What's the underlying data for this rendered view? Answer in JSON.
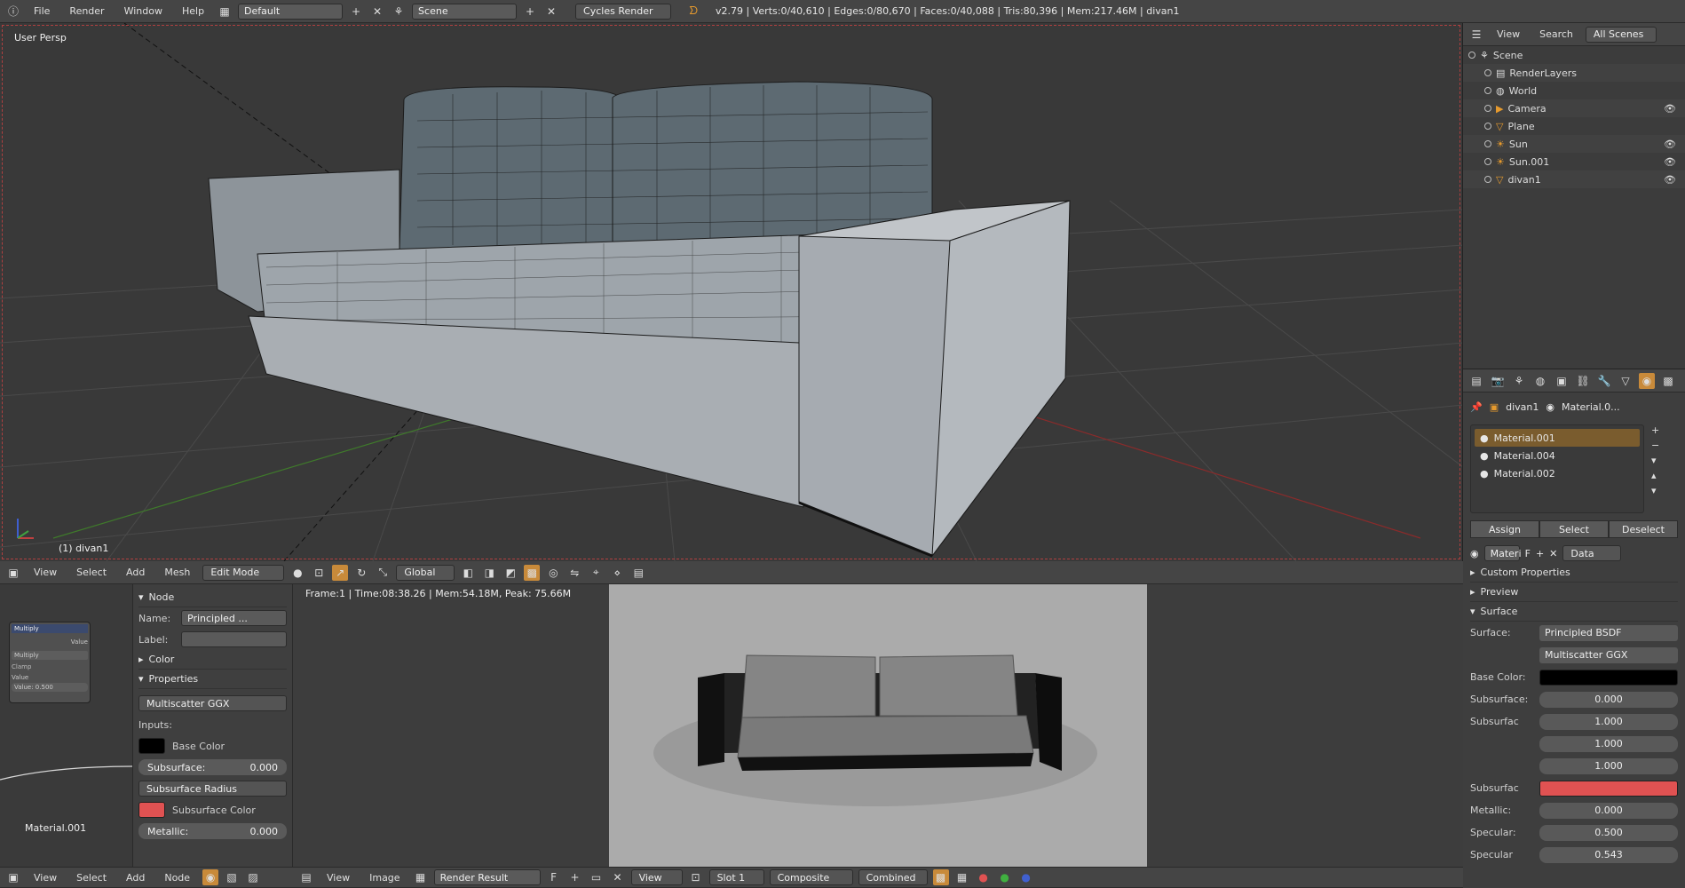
{
  "colors": {
    "accent": "#7a5c2e",
    "base_color": "#000000",
    "subsurface_color": "#e05252",
    "grid": "#4a4a4a",
    "x_axis": "#8a2b2b",
    "y_axis": "#3f7a2b"
  },
  "topbar": {
    "menus": [
      "File",
      "Render",
      "Window",
      "Help"
    ],
    "layout": "Default",
    "scene": "Scene",
    "engine": "Cycles Render",
    "info": "v2.79 | Verts:0/40,610 | Edges:0/80,670 | Faces:0/40,088 | Tris:80,396 | Mem:217.46M | divan1"
  },
  "viewport": {
    "view_label": "User Persp",
    "object_label": "(1) divan1",
    "header": {
      "menus": [
        "View",
        "Select",
        "Add",
        "Mesh"
      ],
      "mode": "Edit Mode",
      "orientation": "Global"
    }
  },
  "node_editor": {
    "node_title": "Multiply",
    "node_output": "Value",
    "node_op": "Multiply",
    "node_clamp": "Clamp",
    "node_value_label": "Value",
    "node_value": "Value:  0.500",
    "material_name": "Material.001"
  },
  "node_sidebar": {
    "node_section": "Node",
    "name_label": "Name:",
    "name_value": "Principled ...",
    "label_label": "Label:",
    "color_section": "Color",
    "properties_section": "Properties",
    "distribution": "Multiscatter GGX",
    "inputs_label": "Inputs:",
    "base_color_label": "Base Color",
    "subsurface_label": "Subsurface:",
    "subsurface_value": "0.000",
    "subsurface_radius": "Subsurface Radius",
    "subsurface_color_label": "Subsurface Color",
    "metallic_label": "Metallic:",
    "metallic_value": "0.000"
  },
  "image_editor": {
    "status": "Frame:1 | Time:08:38.26 | Mem:54.18M, Peak: 75.66M",
    "header": {
      "menus": [
        "View",
        "Image"
      ],
      "image": "Render Result",
      "fake_user": "F",
      "view": "View",
      "slot": "Slot 1",
      "layer": "Composite",
      "pass": "Combined"
    }
  },
  "bottom_left_header": {
    "menus": [
      "View",
      "Select",
      "Add",
      "Node"
    ]
  },
  "outliner": {
    "header": {
      "view": "View",
      "search": "Search",
      "filter": "All Scenes"
    },
    "items": [
      {
        "label": "Scene",
        "indent": 0
      },
      {
        "label": "RenderLayers",
        "indent": 1
      },
      {
        "label": "World",
        "indent": 1
      },
      {
        "label": "Camera",
        "indent": 1
      },
      {
        "label": "Plane",
        "indent": 1
      },
      {
        "label": "Sun",
        "indent": 1
      },
      {
        "label": "Sun.001",
        "indent": 1
      },
      {
        "label": "divan1",
        "indent": 1
      }
    ]
  },
  "properties": {
    "breadcrumb": {
      "object": "divan1",
      "material": "Material.0..."
    },
    "materials": [
      "Material.001",
      "Material.004",
      "Material.002"
    ],
    "buttons": [
      "Assign",
      "Select",
      "Deselect"
    ],
    "mat_field": "Materi",
    "fake_user": "F",
    "link": "Data",
    "sections": {
      "custom": "Custom Properties",
      "preview": "Preview",
      "surface": "Surface"
    },
    "surface": {
      "surface_label": "Surface:",
      "surface_value": "Principled BSDF",
      "distribution": "Multiscatter GGX",
      "base_color_label": "Base Color:",
      "subsurface_label": "Subsurface:",
      "subsurface_value": "0.000",
      "radius_label": "Subsurfac",
      "radius_values": [
        "1.000",
        "1.000",
        "1.000"
      ],
      "subsurface_color_label": "Subsurfac",
      "metallic_label": "Metallic:",
      "metallic_value": "0.000",
      "specular_label": "Specular:",
      "specular_value": "0.500",
      "specular_tint_label": "Specular",
      "specular_tint_value": "0.543"
    }
  }
}
